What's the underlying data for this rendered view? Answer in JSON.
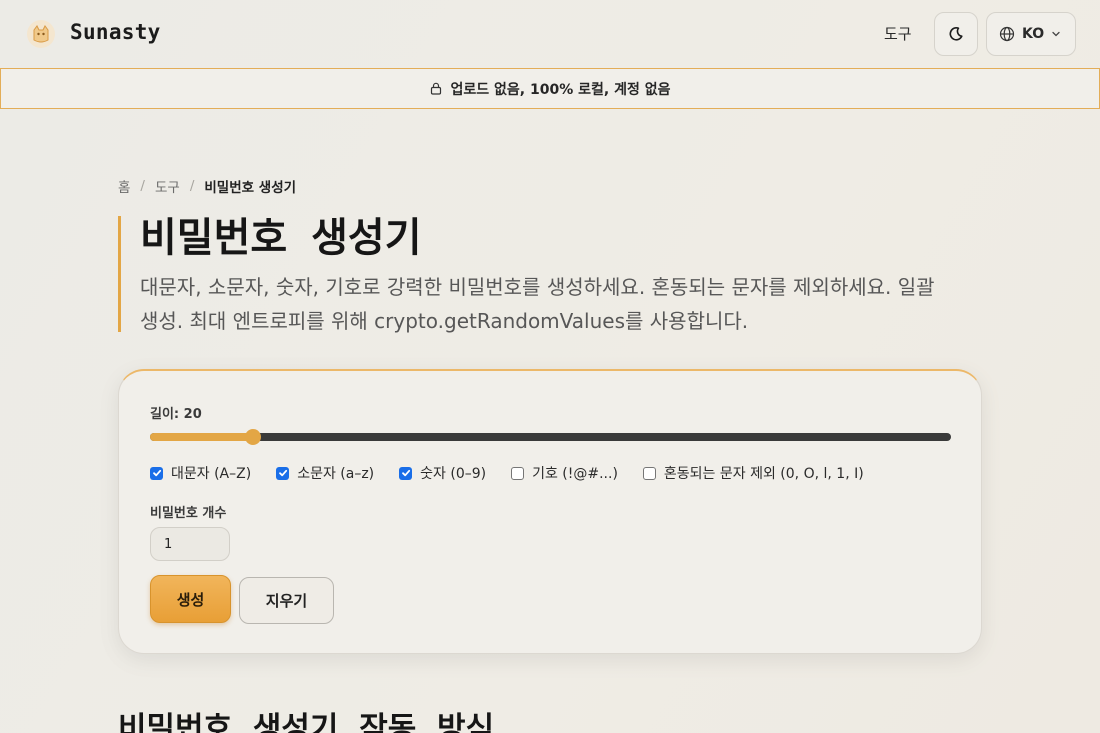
{
  "header": {
    "brand": "Sunasty",
    "nav_tools": "도구",
    "language": "KO",
    "icons": {
      "logo": "fox-logo-icon",
      "theme": "moon-icon",
      "language": "globe-icon",
      "chevron": "chevron-down-icon"
    }
  },
  "banner": {
    "icon": "lock-icon",
    "text": "업로드 없음, 100% 로컬, 계정 없음",
    "border_color": "#e3ad58"
  },
  "breadcrumb": {
    "home": "홈",
    "tools": "도구",
    "current": "비밀번호 생성기"
  },
  "page": {
    "title": "비밀번호 생성기",
    "description": "대문자, 소문자, 숫자, 기호로 강력한 비밀번호를 생성하세요. 혼동되는 문자를 제외하세요. 일괄 생성. 최대 엔트로피를 위해 crypto.getRandomValues를 사용합니다."
  },
  "generator": {
    "length_label": "길이: 20",
    "length_value": 20,
    "length_min": 4,
    "length_max": 128,
    "options": [
      {
        "label": "대문자 (A–Z)",
        "checked": true
      },
      {
        "label": "소문자 (a–z)",
        "checked": true
      },
      {
        "label": "숫자 (0–9)",
        "checked": true
      },
      {
        "label": "기호 (!@#...)",
        "checked": false
      },
      {
        "label": "혼동되는 문자 제외 (0, O, l, 1, I)",
        "checked": false
      }
    ],
    "count_label": "비밀번호 개수",
    "count_value": "1",
    "generate_label": "생성",
    "clear_label": "지우기"
  },
  "section": {
    "heading": "비밀번호 생성기 작동 방식"
  },
  "colors": {
    "accent": "#e3a645",
    "checkbox": "#1a6ee8"
  }
}
